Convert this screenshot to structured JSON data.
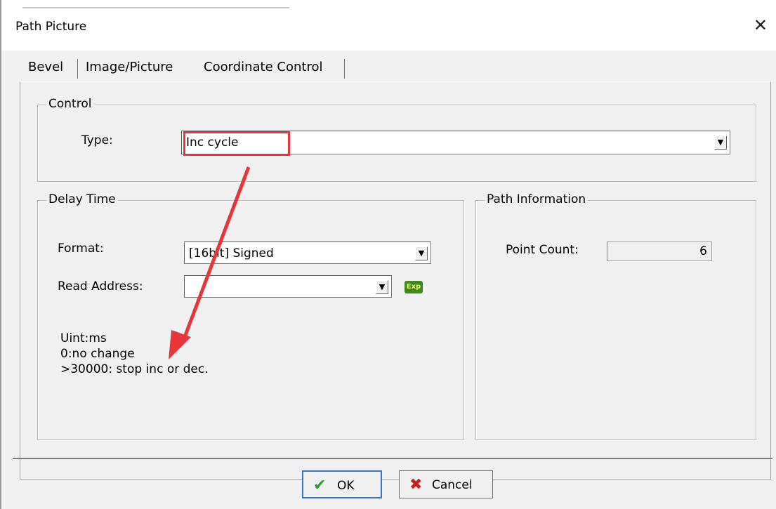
{
  "window": {
    "title": "Path Picture",
    "close_symbol": "✕"
  },
  "tabs": [
    {
      "label": "Bevel"
    },
    {
      "label": "Image/Picture"
    },
    {
      "label": "Coordinate Control"
    }
  ],
  "control_group": {
    "legend": "Control",
    "type_label": "Type:",
    "type_value": "Inc cycle"
  },
  "delay_group": {
    "legend": "Delay Time",
    "format_label": "Format:",
    "format_value": "[16bit] Signed",
    "read_address_label": "Read Address:",
    "read_address_value": "",
    "exp_icon_text": "Exp",
    "notes": [
      "Uint:ms",
      "0:no change",
      ">30000: stop inc or dec."
    ]
  },
  "path_group": {
    "legend": "Path Information",
    "point_count_label": "Point Count:",
    "point_count_value": "6"
  },
  "buttons": {
    "ok": "OK",
    "cancel": "Cancel"
  },
  "colors": {
    "annotation": "#e8353a",
    "ok_check": "#2e9e2e",
    "cancel_x": "#c82020"
  }
}
